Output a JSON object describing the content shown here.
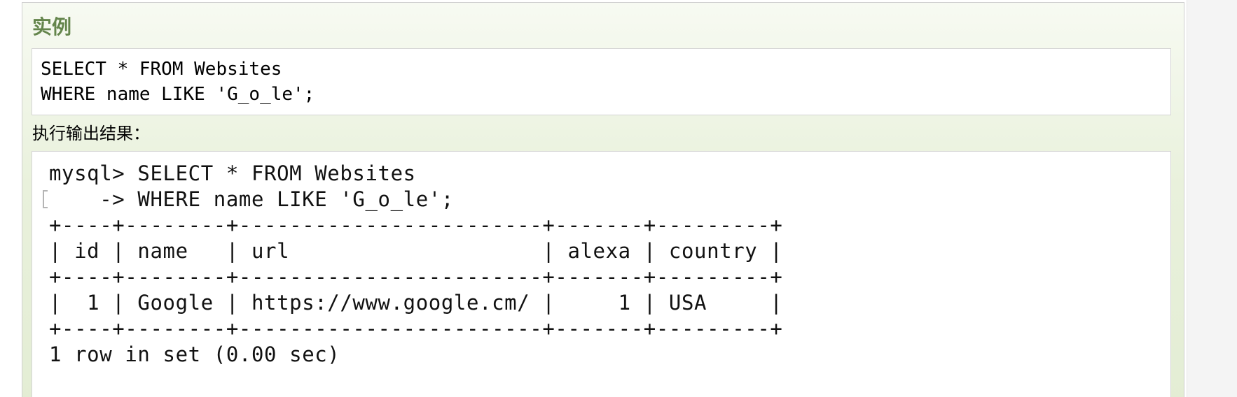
{
  "example": {
    "title": "实例",
    "code_lines": [
      "SELECT * FROM Websites",
      "WHERE name LIKE 'G_o_le';"
    ]
  },
  "output": {
    "label": "执行输出结果：",
    "terminal_lines": [
      "mysql> SELECT * FROM Websites",
      "    -> WHERE name LIKE 'G_o_le';",
      "+----+--------+------------------------+-------+---------+",
      "| id | name   | url                    | alexa | country |",
      "+----+--------+------------------------+-------+---------+",
      "|  1 | Google | https://www.google.cm/ |     1 | USA     |",
      "+----+--------+------------------------+-------+---------+",
      "1 row in set (0.00 sec)"
    ]
  },
  "table": {
    "columns": [
      "id",
      "name",
      "url",
      "alexa",
      "country"
    ],
    "rows": [
      [
        "1",
        "Google",
        "https://www.google.cm/",
        "1",
        "USA"
      ]
    ]
  },
  "colors": {
    "title_green": "#64854c",
    "panel_background": "#e9f1dc"
  }
}
